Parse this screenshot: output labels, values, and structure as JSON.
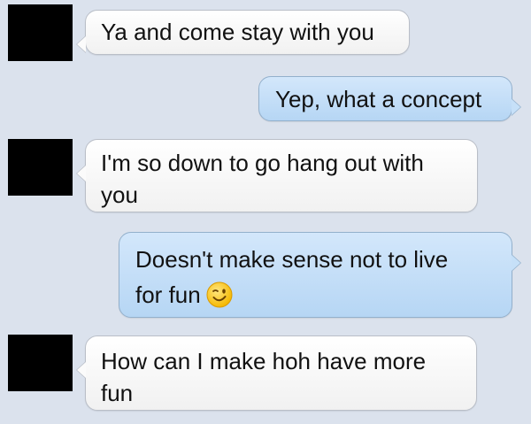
{
  "conversation": {
    "messages": [
      {
        "sender": "other",
        "text": "Ya and come stay with you"
      },
      {
        "sender": "me",
        "text": "Yep, what a concept"
      },
      {
        "sender": "other",
        "text": "I'm so down to go hang out with\nyou"
      },
      {
        "sender": "me",
        "text": "Doesn't make sense not to live\nfor fun",
        "emoji": "winking-face-emoji"
      },
      {
        "sender": "other",
        "text": "How can I make hoh have more\nfun"
      }
    ]
  },
  "colors": {
    "background": "#dbe2ed",
    "incoming_bubble": "#ffffff",
    "outgoing_bubble": "#c6e0f8",
    "avatar_redaction": "#000000"
  }
}
